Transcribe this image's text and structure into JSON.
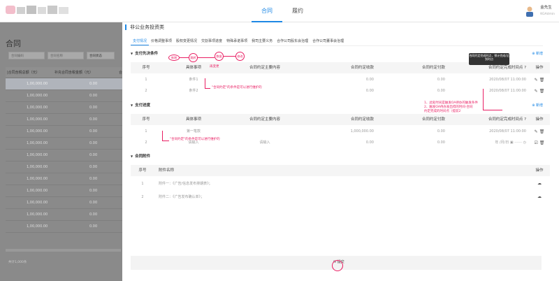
{
  "topbar": {
    "tabs": [
      {
        "label": "合同"
      },
      {
        "label": "履约"
      }
    ],
    "user": {
      "name": "金先生",
      "role": "KGAdmin"
    }
  },
  "left": {
    "title": "合同",
    "filters": {
      "contract_no": "合同编码",
      "contract_name": "合同名称",
      "contract_status": "合同状态"
    },
    "columns": [
      "|合同含税总额（元）",
      "补充合同含税金额（元）",
      "合"
    ],
    "rows": [
      {
        "amount": "1,00,000.00",
        "extra": "0.00"
      },
      {
        "amount": "1,00,000.00",
        "extra": "0.00"
      },
      {
        "amount": "1,00,000.00",
        "extra": "0.00"
      },
      {
        "amount": "1,00,000.00",
        "extra": "0.00"
      },
      {
        "amount": "1,00,000.00",
        "extra": "0.00"
      },
      {
        "amount": "1,00,000.00",
        "extra": "0.00"
      },
      {
        "amount": "1,00,000.00",
        "extra": "0.00"
      },
      {
        "amount": "1,00,000.00",
        "extra": "0.00"
      },
      {
        "amount": "1,00,000.00",
        "extra": "0.00"
      },
      {
        "amount": "1,00,000.00",
        "extra": "0.00"
      },
      {
        "amount": "1,00,000.00",
        "extra": "0.00"
      },
      {
        "amount": "1,00,000.00",
        "extra": "0.00"
      },
      {
        "amount": "1,00,000.00",
        "extra": "0.00"
      }
    ],
    "total": "共计1,000条"
  },
  "panel": {
    "title": "非公业务投资类",
    "tabs": [
      "支付情况",
      "价格调整事项",
      "股权变更情况",
      "交割事项进度",
      "特殊承诺事项",
      "我司主要义务",
      "合作公司股东会治理",
      "合作公司董事会治理"
    ],
    "add_label": "新增",
    "sec1": {
      "title": "支付先决条件",
      "cols": [
        "序号",
        "具体事项",
        "合同约定主要内容",
        "合同约定收款",
        "合同约定付款",
        "合同约定完成时间点",
        "操作"
      ],
      "rows": [
        {
          "no": "1",
          "item": "条件1",
          "content": "",
          "recv": "0.00",
          "pay": "0.00",
          "time": "2020/08/07 11:00:00"
        },
        {
          "no": "2",
          "item": "条件2",
          "content": "",
          "recv": "0.00",
          "pay": "0.00",
          "time": "2020/08/07 11:00:00"
        }
      ]
    },
    "sec2": {
      "title": "支付进度",
      "cols": [
        "序号",
        "具体事项",
        "合同约定主要内容",
        "合同约定收款",
        "合同约定付款",
        "合同约定完成时间点",
        "操作"
      ],
      "rows": [
        {
          "no": "1",
          "item": "第一笔款",
          "content": "",
          "recv": "1,000,000.00",
          "pay": "0.00",
          "time": "2020/08/07 11:00:00"
        },
        {
          "no": "2",
          "item": "请输入",
          "content": "请输入",
          "recv": "0.00",
          "pay": "0.00",
          "time": "年 /月/日"
        }
      ]
    },
    "sec3": {
      "title": "合同附件",
      "cols": [
        "序号",
        "附件名称",
        "操作"
      ],
      "rows": [
        {
          "no": "1",
          "name": "附件一：《广告/信息发布排期表》；"
        },
        {
          "no": "2",
          "name": "附件二：《广告发布确认单》；"
        }
      ]
    },
    "submit": "提交"
  },
  "annotations": {
    "tooltip": "合同约定完成时点，预计完成/达到时点",
    "note1": "\"合同约定\"的条件是可以进行维护的",
    "note2": "\"合同约定\"的条件是可以进行维护的",
    "note3a": "1、此处时间是触发OA待办的触发条件",
    "note3b": "2、触发OA待办发出得的时间-合同",
    "note3c": "约定完成的时间点（提前2",
    "c1": "新增",
    "c2": "跳转",
    "c3": "数据",
    "c4": "修改",
    "edit": "再变更"
  }
}
